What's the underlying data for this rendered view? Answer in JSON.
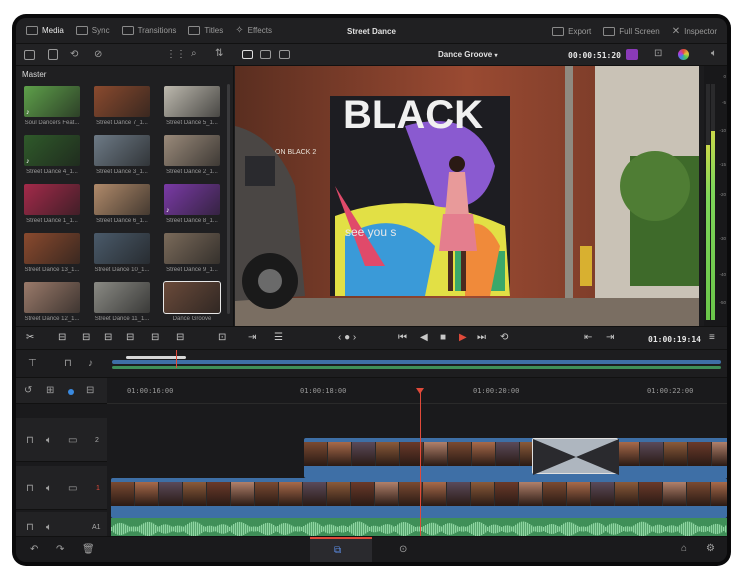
{
  "topbar": {
    "items": [
      {
        "label": "Media",
        "icon": "media-icon",
        "active": true
      },
      {
        "label": "Sync",
        "icon": "sync-icon"
      },
      {
        "label": "Transitions",
        "icon": "transitions-icon"
      },
      {
        "label": "Titles",
        "icon": "titles-icon"
      },
      {
        "label": "Effects",
        "icon": "effects-icon"
      }
    ],
    "project_title": "Street Dance",
    "right_items": [
      {
        "label": "Export",
        "icon": "export-icon"
      },
      {
        "label": "Full Screen",
        "icon": "fullscreen-icon"
      },
      {
        "label": "Inspector",
        "icon": "inspector-icon"
      }
    ]
  },
  "viewer_bar": {
    "timeline_name": "Dance Groove",
    "timecode": "00:00:51:20"
  },
  "media_pool": {
    "folder": "Master",
    "clips": [
      {
        "name": "Soul Dancers Feat...",
        "audio": true,
        "color": "#5ea04a"
      },
      {
        "name": "Street Dance 7_1...",
        "color": "#8a4a2e"
      },
      {
        "name": "Street Dance 5_1...",
        "color": "#bdb9ae"
      },
      {
        "name": "Street Dance 4_1...",
        "audio": true,
        "color": "#2f5a2a"
      },
      {
        "name": "Street Dance 3_1...",
        "color": "#6d7a86"
      },
      {
        "name": "Street Dance 2_1...",
        "color": "#9a8a7a"
      },
      {
        "name": "Street Dance 1_1...",
        "color": "#a32a4a"
      },
      {
        "name": "Street Dance 6_1...",
        "color": "#b08a6a"
      },
      {
        "name": "Street Dance 8_1...",
        "audio": true,
        "color": "#7a3aa6"
      },
      {
        "name": "Street Dance 13_1...",
        "color": "#8a4a2e"
      },
      {
        "name": "Street Dance 10_1...",
        "color": "#4a5a6a"
      },
      {
        "name": "Street Dance 9_1...",
        "color": "#7a6a5a"
      },
      {
        "name": "Street Dance 12_1...",
        "color": "#9a7a6a"
      },
      {
        "name": "Street Dance 11_1...",
        "color": "#8a8a84"
      },
      {
        "name": "Dance Groove",
        "selected": true,
        "color": "#6a4a3a"
      }
    ]
  },
  "viewer": {
    "graffiti_text_1": "BLACK",
    "graffiti_text_2": "ON BLACK 2",
    "graffiti_text_3": "see you s"
  },
  "meters": {
    "scale": [
      "0",
      "-5",
      "-10",
      "-15",
      "-20",
      "-30",
      "-40",
      "-50"
    ],
    "left_level": 0.74,
    "right_level": 0.8
  },
  "transport": {
    "timecode": "01:00:19:14"
  },
  "timeline": {
    "ruler": [
      "01:00:16:00",
      "01:00:18:00",
      "01:00:20:00",
      "01:00:22:00"
    ],
    "tracks": [
      {
        "label": "2"
      },
      {
        "label": "1"
      },
      {
        "label": "A1"
      }
    ]
  },
  "colors": {
    "accent_red": "#e04a3a",
    "video_clip": "#3e6fa6",
    "audio_clip": "#3f8f58",
    "meter_green": "#6ac54a"
  }
}
